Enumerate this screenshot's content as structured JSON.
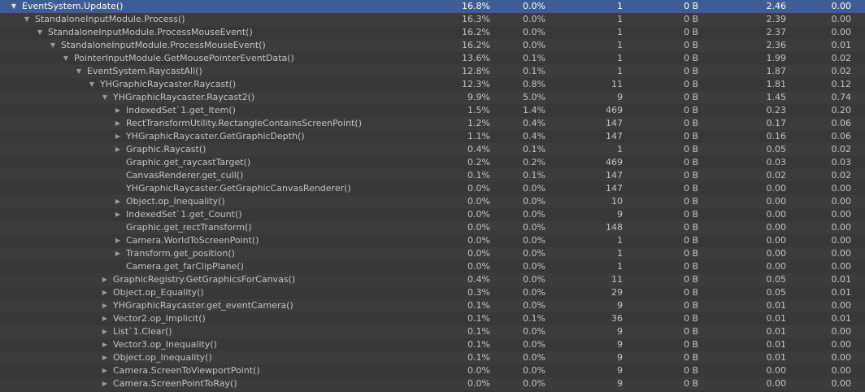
{
  "rows": [
    {
      "name": "EventSystem.Update()",
      "depth": 0,
      "toggle": "expanded",
      "total": "16.8%",
      "self": "0.0%",
      "calls": "1",
      "gc": "0 B",
      "time_ms": "2.46",
      "self_ms": "0.00",
      "selected": true
    },
    {
      "name": "StandaloneInputModule.Process()",
      "depth": 1,
      "toggle": "expanded",
      "total": "16.3%",
      "self": "0.0%",
      "calls": "1",
      "gc": "0 B",
      "time_ms": "2.39",
      "self_ms": "0.00"
    },
    {
      "name": "StandaloneInputModule.ProcessMouseEvent()",
      "depth": 2,
      "toggle": "expanded",
      "total": "16.2%",
      "self": "0.0%",
      "calls": "1",
      "gc": "0 B",
      "time_ms": "2.37",
      "self_ms": "0.00"
    },
    {
      "name": "StandaloneInputModule.ProcessMouseEvent()",
      "depth": 3,
      "toggle": "expanded",
      "total": "16.2%",
      "self": "0.0%",
      "calls": "1",
      "gc": "0 B",
      "time_ms": "2.36",
      "self_ms": "0.01"
    },
    {
      "name": "PointerInputModule.GetMousePointerEventData()",
      "depth": 4,
      "toggle": "expanded",
      "total": "13.6%",
      "self": "0.1%",
      "calls": "1",
      "gc": "0 B",
      "time_ms": "1.99",
      "self_ms": "0.02"
    },
    {
      "name": "EventSystem.RaycastAll()",
      "depth": 5,
      "toggle": "expanded",
      "total": "12.8%",
      "self": "0.1%",
      "calls": "1",
      "gc": "0 B",
      "time_ms": "1.87",
      "self_ms": "0.02"
    },
    {
      "name": "YHGraphicRaycaster.Raycast()",
      "depth": 6,
      "toggle": "expanded",
      "total": "12.3%",
      "self": "0.8%",
      "calls": "11",
      "gc": "0 B",
      "time_ms": "1.81",
      "self_ms": "0.12"
    },
    {
      "name": "YHGraphicRaycaster.Raycast2()",
      "depth": 7,
      "toggle": "expanded",
      "total": "9.9%",
      "self": "5.0%",
      "calls": "9",
      "gc": "0 B",
      "time_ms": "1.45",
      "self_ms": "0.74"
    },
    {
      "name": "IndexedSet`1.get_Item()",
      "depth": 8,
      "toggle": "collapsed",
      "total": "1.5%",
      "self": "1.4%",
      "calls": "469",
      "gc": "0 B",
      "time_ms": "0.23",
      "self_ms": "0.20"
    },
    {
      "name": "RectTransformUtility.RectangleContainsScreenPoint()",
      "depth": 8,
      "toggle": "collapsed",
      "total": "1.2%",
      "self": "0.4%",
      "calls": "147",
      "gc": "0 B",
      "time_ms": "0.17",
      "self_ms": "0.06"
    },
    {
      "name": "YHGraphicRaycaster.GetGraphicDepth()",
      "depth": 8,
      "toggle": "collapsed",
      "total": "1.1%",
      "self": "0.4%",
      "calls": "147",
      "gc": "0 B",
      "time_ms": "0.16",
      "self_ms": "0.06"
    },
    {
      "name": "Graphic.Raycast()",
      "depth": 8,
      "toggle": "collapsed",
      "total": "0.4%",
      "self": "0.1%",
      "calls": "1",
      "gc": "0 B",
      "time_ms": "0.05",
      "self_ms": "0.02"
    },
    {
      "name": "Graphic.get_raycastTarget()",
      "depth": 8,
      "toggle": "none",
      "total": "0.2%",
      "self": "0.2%",
      "calls": "469",
      "gc": "0 B",
      "time_ms": "0.03",
      "self_ms": "0.03"
    },
    {
      "name": "CanvasRenderer.get_cull()",
      "depth": 8,
      "toggle": "none",
      "total": "0.1%",
      "self": "0.1%",
      "calls": "147",
      "gc": "0 B",
      "time_ms": "0.02",
      "self_ms": "0.02"
    },
    {
      "name": "YHGraphicRaycaster.GetGraphicCanvasRenderer()",
      "depth": 8,
      "toggle": "none",
      "total": "0.0%",
      "self": "0.0%",
      "calls": "147",
      "gc": "0 B",
      "time_ms": "0.00",
      "self_ms": "0.00"
    },
    {
      "name": "Object.op_Inequality()",
      "depth": 8,
      "toggle": "collapsed",
      "total": "0.0%",
      "self": "0.0%",
      "calls": "10",
      "gc": "0 B",
      "time_ms": "0.00",
      "self_ms": "0.00"
    },
    {
      "name": "IndexedSet`1.get_Count()",
      "depth": 8,
      "toggle": "collapsed",
      "total": "0.0%",
      "self": "0.0%",
      "calls": "9",
      "gc": "0 B",
      "time_ms": "0.00",
      "self_ms": "0.00"
    },
    {
      "name": "Graphic.get_rectTransform()",
      "depth": 8,
      "toggle": "none",
      "total": "0.0%",
      "self": "0.0%",
      "calls": "148",
      "gc": "0 B",
      "time_ms": "0.00",
      "self_ms": "0.00"
    },
    {
      "name": "Camera.WorldToScreenPoint()",
      "depth": 8,
      "toggle": "collapsed",
      "total": "0.0%",
      "self": "0.0%",
      "calls": "1",
      "gc": "0 B",
      "time_ms": "0.00",
      "self_ms": "0.00"
    },
    {
      "name": "Transform.get_position()",
      "depth": 8,
      "toggle": "collapsed",
      "total": "0.0%",
      "self": "0.0%",
      "calls": "1",
      "gc": "0 B",
      "time_ms": "0.00",
      "self_ms": "0.00"
    },
    {
      "name": "Camera.get_farClipPlane()",
      "depth": 8,
      "toggle": "none",
      "total": "0.0%",
      "self": "0.0%",
      "calls": "1",
      "gc": "0 B",
      "time_ms": "0.00",
      "self_ms": "0.00"
    },
    {
      "name": "GraphicRegistry.GetGraphicsForCanvas()",
      "depth": 7,
      "toggle": "collapsed",
      "total": "0.4%",
      "self": "0.0%",
      "calls": "11",
      "gc": "0 B",
      "time_ms": "0.05",
      "self_ms": "0.01"
    },
    {
      "name": "Object.op_Equality()",
      "depth": 7,
      "toggle": "collapsed",
      "total": "0.3%",
      "self": "0.0%",
      "calls": "29",
      "gc": "0 B",
      "time_ms": "0.05",
      "self_ms": "0.01"
    },
    {
      "name": "YHGraphicRaycaster.get_eventCamera()",
      "depth": 7,
      "toggle": "collapsed",
      "total": "0.1%",
      "self": "0.0%",
      "calls": "9",
      "gc": "0 B",
      "time_ms": "0.01",
      "self_ms": "0.00"
    },
    {
      "name": "Vector2.op_Implicit()",
      "depth": 7,
      "toggle": "collapsed",
      "total": "0.1%",
      "self": "0.1%",
      "calls": "36",
      "gc": "0 B",
      "time_ms": "0.01",
      "self_ms": "0.01"
    },
    {
      "name": "List`1.Clear()",
      "depth": 7,
      "toggle": "collapsed",
      "total": "0.1%",
      "self": "0.0%",
      "calls": "9",
      "gc": "0 B",
      "time_ms": "0.01",
      "self_ms": "0.00"
    },
    {
      "name": "Vector3.op_Inequality()",
      "depth": 7,
      "toggle": "collapsed",
      "total": "0.1%",
      "self": "0.0%",
      "calls": "9",
      "gc": "0 B",
      "time_ms": "0.01",
      "self_ms": "0.00"
    },
    {
      "name": "Object.op_Inequality()",
      "depth": 7,
      "toggle": "collapsed",
      "total": "0.1%",
      "self": "0.0%",
      "calls": "9",
      "gc": "0 B",
      "time_ms": "0.01",
      "self_ms": "0.00"
    },
    {
      "name": "Camera.ScreenToViewportPoint()",
      "depth": 7,
      "toggle": "collapsed",
      "total": "0.0%",
      "self": "0.0%",
      "calls": "9",
      "gc": "0 B",
      "time_ms": "0.00",
      "self_ms": "0.00"
    },
    {
      "name": "Camera.ScreenPointToRay()",
      "depth": 7,
      "toggle": "collapsed",
      "total": "0.0%",
      "self": "0.0%",
      "calls": "9",
      "gc": "0 B",
      "time_ms": "0.00",
      "self_ms": "0.00"
    }
  ],
  "icons": {
    "expanded": "chevron-down-icon",
    "collapsed": "chevron-right-icon"
  },
  "colors": {
    "background": "#383838",
    "row_alt": "#3c3c3c",
    "selected": "#3d5d94",
    "text": "#c4c4c4"
  }
}
